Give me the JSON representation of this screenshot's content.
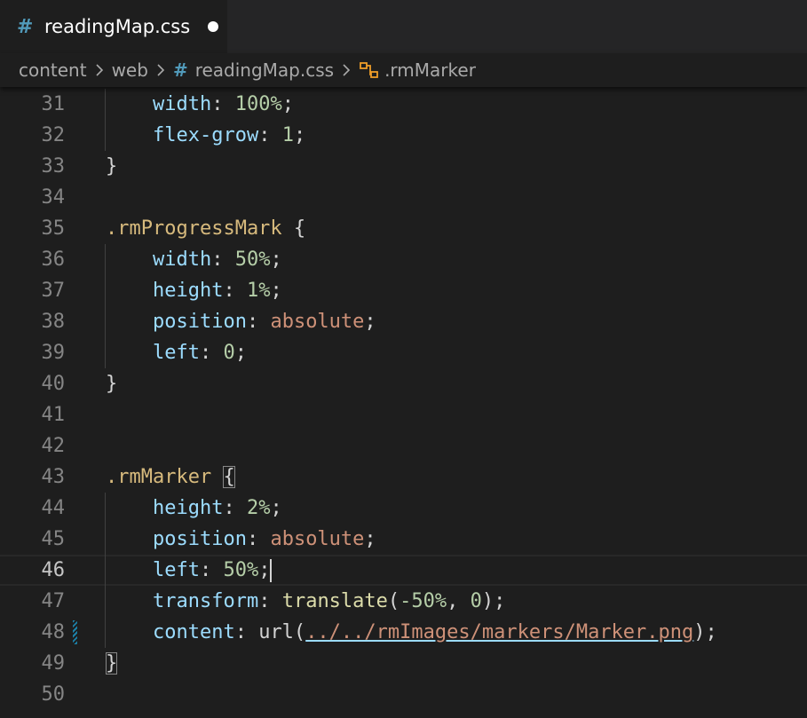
{
  "tab": {
    "icon": "#",
    "title": "readingMap.css",
    "dirty_indicator": "●"
  },
  "breadcrumb": {
    "items": [
      "content",
      "web",
      "readingMap.css",
      ".rmMarker"
    ],
    "separator": "›",
    "file_icon": "#"
  },
  "editor": {
    "current_line": 46,
    "lines": [
      {
        "n": "31",
        "code": "    width: 100%;"
      },
      {
        "n": "32",
        "code": "    flex-grow: 1;"
      },
      {
        "n": "33",
        "code": "}"
      },
      {
        "n": "34",
        "code": ""
      },
      {
        "n": "35",
        "code": ".rmProgressMark {"
      },
      {
        "n": "36",
        "code": "    width: 50%;"
      },
      {
        "n": "37",
        "code": "    height: 1%;"
      },
      {
        "n": "38",
        "code": "    position: absolute;"
      },
      {
        "n": "39",
        "code": "    left: 0;"
      },
      {
        "n": "40",
        "code": "}"
      },
      {
        "n": "41",
        "code": ""
      },
      {
        "n": "42",
        "code": ""
      },
      {
        "n": "43",
        "code": ".rmMarker {"
      },
      {
        "n": "44",
        "code": "    height: 2%;"
      },
      {
        "n": "45",
        "code": "    position: absolute;"
      },
      {
        "n": "46",
        "code": "    left: 50%;"
      },
      {
        "n": "47",
        "code": "    transform: translate(-50%, 0);"
      },
      {
        "n": "48",
        "code": "    content: url(../../rmImages/markers/Marker.png);"
      },
      {
        "n": "49",
        "code": "}"
      },
      {
        "n": "50",
        "code": ""
      }
    ]
  },
  "colors": {
    "background": "#1e1e1e",
    "selector": "#d7ba7d",
    "property": "#9cdcfe",
    "number": "#b5cea8",
    "string_value": "#ce9178",
    "function": "#dcdcaa",
    "modified_gutter": "#1b81a8"
  }
}
